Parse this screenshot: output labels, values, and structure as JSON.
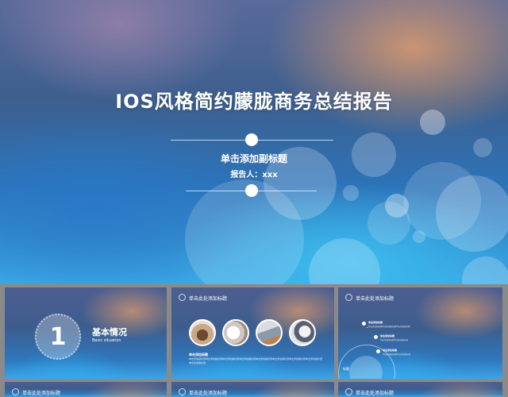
{
  "hero": {
    "title": "IOS风格简约朦胧商务总结报告",
    "subtitle": "单击添加副标题",
    "presenter": "报告人：xxx"
  },
  "thumbnails": [
    {
      "number": "1",
      "label": "基本情况",
      "sublabel": "Basic situation"
    },
    {
      "title": "单击此处添加标题",
      "photos": [
        "paper-clip-photo",
        "desk-photo",
        "keyboard-photo",
        "workspace-photo"
      ],
      "text_heading": "单击添加标题",
      "text_body": "单击添加副标题单击添加副标题单击添加副标题单击添加副标题单击添加副标题单击添加副标题单击添加副标题单击添加副标题单击添加副标题"
    },
    {
      "title": "单击此处添加标题",
      "tag": "标题",
      "items": [
        {
          "heading": "单击添加标题",
          "text": "单击添加副标题单击添加副标题单击添加副标题"
        },
        {
          "heading": "单击添加标题",
          "text": "单击添加副标题单击添加副标题"
        },
        {
          "heading": "单击添加标题",
          "text": "单击添加副标题单击添加副标题"
        }
      ]
    },
    {
      "title": "单击此处添加标题"
    },
    {
      "title": "单击此处添加标题"
    },
    {
      "title": "单击此处添加标题"
    }
  ]
}
